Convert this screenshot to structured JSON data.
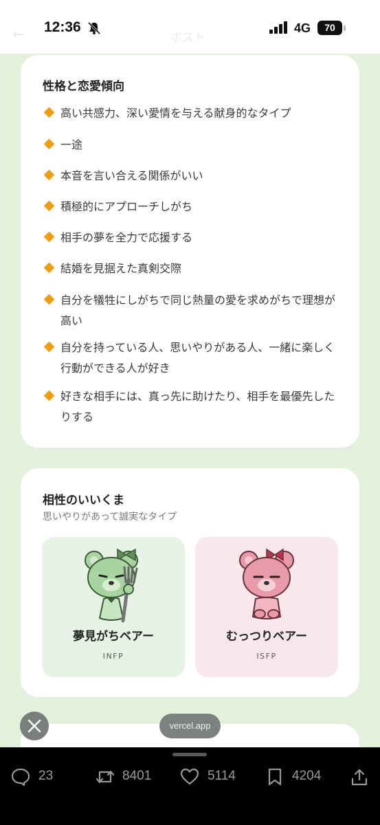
{
  "status_bar": {
    "time": "12:36",
    "network": "4G",
    "battery": "70",
    "ghost_title": "ポスト"
  },
  "personality": {
    "title": "性格と恋愛傾向",
    "traits": [
      "高い共感力、深い愛情を与える献身的なタイプ",
      "一途",
      "本音を言い合える関係がいい",
      "積極的にアプローチしがち",
      "相手の夢を全力で応援する",
      "結婚を見据えた真剣交際",
      "自分を犠牲にしがちで同じ熱量の愛を求めがちで理想が高い",
      "自分を持っている人、思いやりがある人、一緒に楽しく行動ができる人が好き",
      "好きな相手には、真っ先に助けたり、相手を最優先したりする"
    ]
  },
  "compatibility": {
    "title": "相性のいいくま",
    "subtitle": "思いやりがあって誠実なタイプ",
    "bears": [
      {
        "name": "夢見がちベアー",
        "type": "INFP",
        "color": "#a8d4a0"
      },
      {
        "name": "むっつりベアー",
        "type": "ISFP",
        "color": "#e89aa8"
      }
    ]
  },
  "overlay": {
    "domain": "vercel.app"
  },
  "actions": {
    "replies": "23",
    "reposts": "8401",
    "likes": "5114",
    "bookmarks": "4204"
  },
  "colors": {
    "background": "#e3f0dc",
    "accent": "#f29b0b"
  }
}
